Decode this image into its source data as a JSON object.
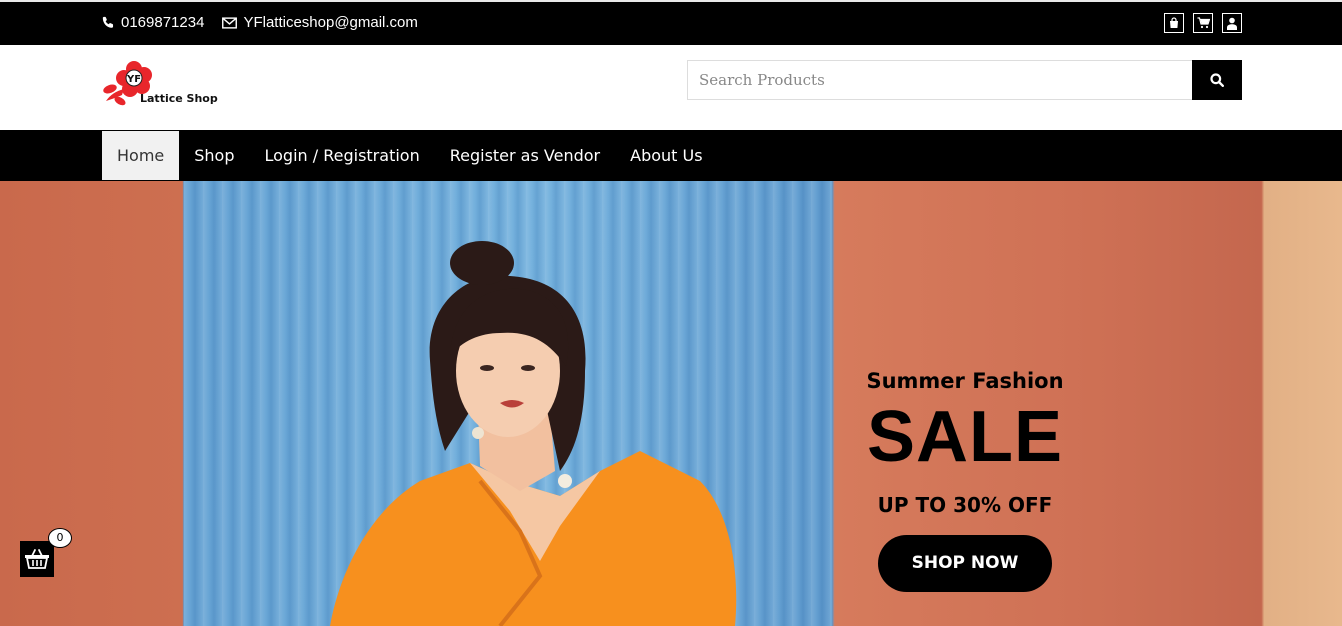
{
  "topbar": {
    "phone": "0169871234",
    "email": "YFlatticeshop@gmail.com",
    "icons": [
      "shopping-bag-icon",
      "cart-icon",
      "user-icon"
    ]
  },
  "header": {
    "logo_mark": "YF",
    "logo_text": "Lattice Shop",
    "search_placeholder": "Search Products"
  },
  "nav": {
    "items": [
      "Home",
      "Shop",
      "Login / Registration",
      "Register as Vendor",
      "About Us"
    ],
    "active": "Home"
  },
  "hero": {
    "subtitle": "Summer Fashion",
    "headline": "SALE",
    "offer": "UP TO 30% OFF",
    "cta": "SHOP NOW"
  },
  "basket": {
    "count": "0"
  },
  "colors": {
    "bar": "#000000",
    "logo_red": "#e8262b"
  }
}
